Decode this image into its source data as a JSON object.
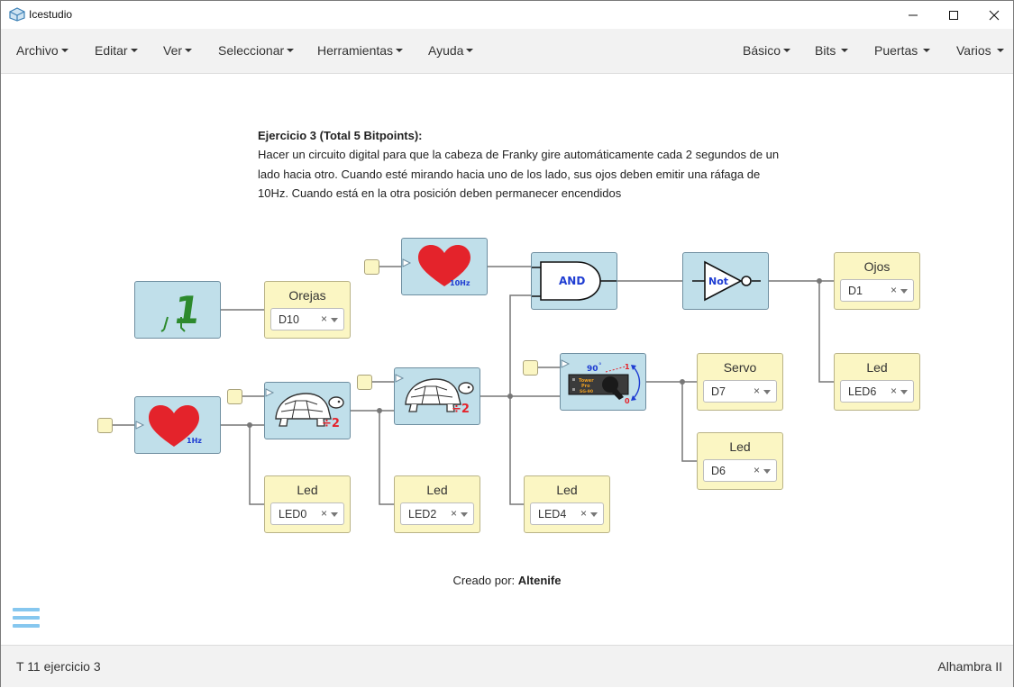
{
  "window": {
    "title": "Icestudio"
  },
  "menus_left": [
    "Archivo",
    "Editar",
    "Ver",
    "Seleccionar",
    "Herramientas",
    "Ayuda"
  ],
  "menus_right": [
    "Básico",
    "Bits",
    "Puertas",
    "Varios"
  ],
  "description": {
    "title": "Ejercicio 3 (Total 5 Bitpoints):",
    "line1": "Hacer un circuito digital para que la cabeza de Franky gire automáticamente cada 2 segundos de un",
    "line2": "lado hacia otro. Cuando esté mirando hacia uno de los lado, sus ojos deben emitir una ráfaga de",
    "line3": "10Hz. Cuando está en la otra posición deben permanecer encendidos"
  },
  "blocks": {
    "const_one": "1",
    "heart_1hz": "1Hz",
    "heart_10hz": "10Hz",
    "div_a": "÷2",
    "div_b": "÷2",
    "and_gate": "AND",
    "not_gate": "Not",
    "servo_angle": "90",
    "servo_deg": "°",
    "servo_one": "1",
    "servo_zero": "0",
    "servo_brand1": "Tower",
    "servo_brand2": "Pro",
    "servo_model": "SG-90"
  },
  "outputs": {
    "orejas": {
      "label": "Orejas",
      "value": "D10"
    },
    "ojos": {
      "label": "Ojos",
      "value": "D1"
    },
    "led_ojos": {
      "label": "Led",
      "value": "LED6"
    },
    "servo": {
      "label": "Servo",
      "value": "D7"
    },
    "led_d6": {
      "label": "Led",
      "value": "D6"
    },
    "led0": {
      "label": "Led",
      "value": "LED0"
    },
    "led2": {
      "label": "Led",
      "value": "LED2"
    },
    "led4": {
      "label": "Led",
      "value": "LED4"
    }
  },
  "clear_symbol": "×",
  "credit": {
    "prefix": "Creado por:",
    "author": "Altenife"
  },
  "status": {
    "left": "T 11 ejercicio 3",
    "right": "Alhambra II"
  },
  "colors": {
    "block": "#c0dfea",
    "io": "#fbf6c3",
    "wire": "#777777",
    "heart": "#e4232b",
    "accent": "#1e3cd2"
  }
}
